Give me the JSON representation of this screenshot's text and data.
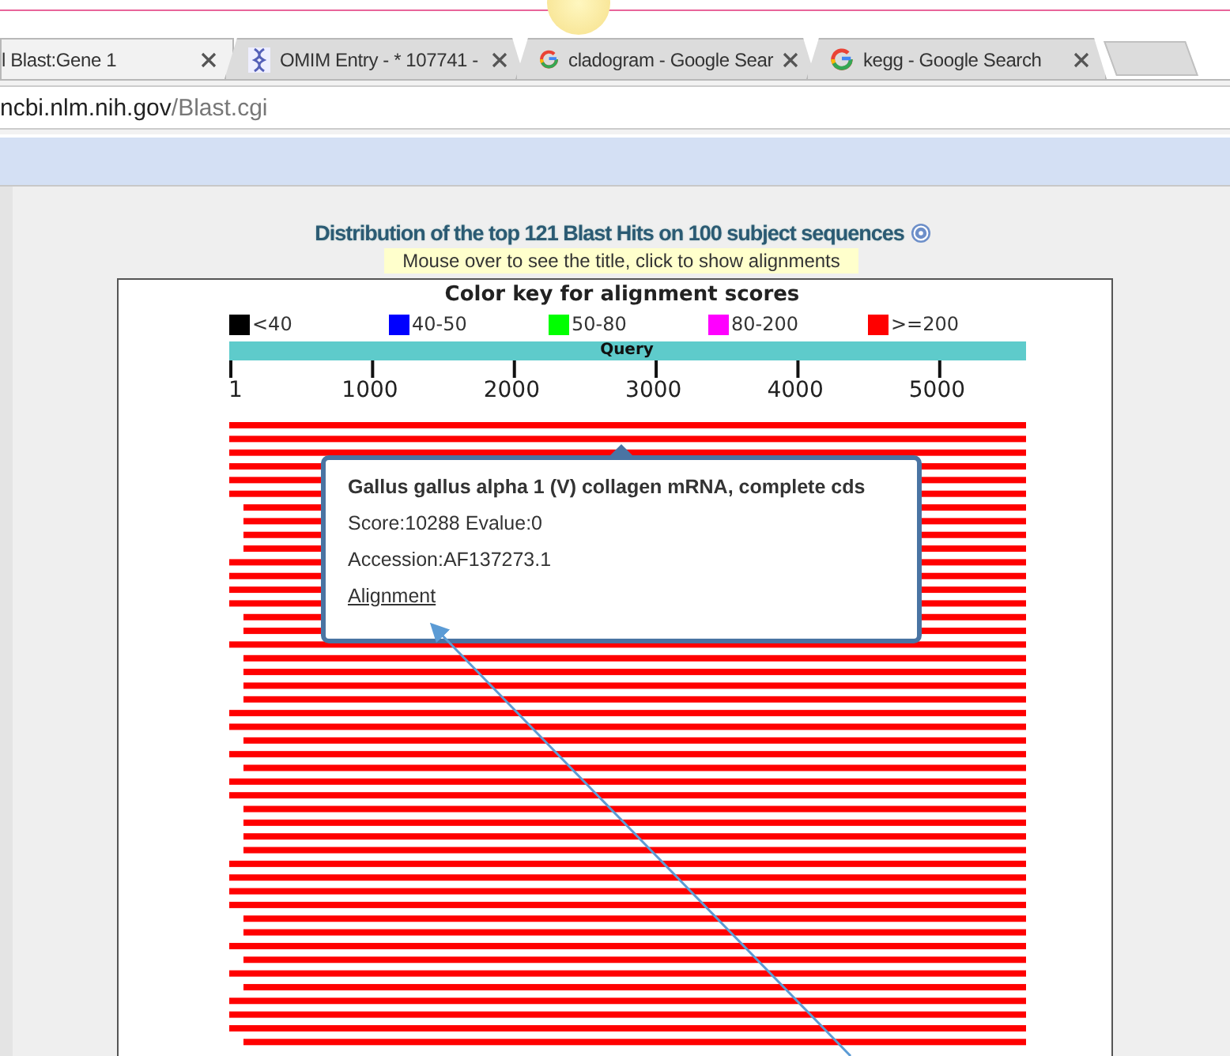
{
  "tabs": [
    {
      "label": "l Blast:Gene 1",
      "selected": true
    },
    {
      "label": "OMIM Entry - * 107741 -",
      "selected": false
    },
    {
      "label": "cladogram - Google Sear",
      "selected": false
    },
    {
      "label": "kegg - Google Search",
      "selected": false
    }
  ],
  "address": {
    "host": "ncbi.nlm.nih.gov",
    "path": "/Blast.cgi"
  },
  "graphic": {
    "title": "Distribution of the top 121 Blast Hits on 100 subject sequences",
    "hint": "Mouse over to see the title, click to show alignments",
    "key_title": "Color key for alignment scores",
    "legend": [
      {
        "label": "<40",
        "color": "#000000"
      },
      {
        "label": "40-50",
        "color": "#0000ff"
      },
      {
        "label": "50-80",
        "color": "#00ff00"
      },
      {
        "label": "80-200",
        "color": "#ff00ff"
      },
      {
        "label": ">=200",
        "color": "#ff0000"
      }
    ],
    "query_label": "Query",
    "ticks": [
      "1",
      "1000",
      "2000",
      "3000",
      "4000",
      "5000"
    ]
  },
  "tooltip": {
    "title": "Gallus gallus alpha 1 (V) collagen mRNA, complete cds",
    "score": "Score:10288 Evalue:0",
    "accession": "Accession:AF137273.1",
    "link": "Alignment"
  }
}
